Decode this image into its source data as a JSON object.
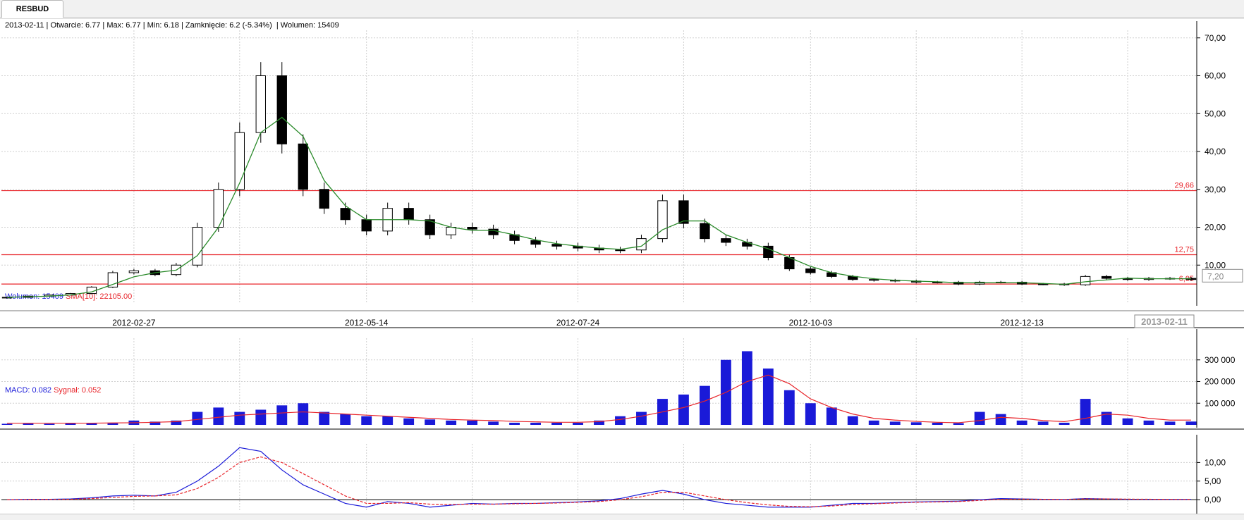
{
  "tab": {
    "label": "RESBUD"
  },
  "price_header": {
    "date": "2013-02-11",
    "open": "Otwarcie: 6.77",
    "high": "Max: 6.77",
    "low": "Min: 6.18",
    "close": "Zamknięcie: 6.2 (-5.34%)",
    "volume": "Wolumen: 15409"
  },
  "volume_header": {
    "volume": "Wolumen: 15409",
    "sma": "SMA[10]: 22105.00"
  },
  "macd_header": {
    "macd": "MACD: 0.082",
    "signal": "Sygnał: 0.052"
  },
  "x_cursor_label": "2013-02-11",
  "y_cursor_label": "7,20",
  "colors": {
    "grid": "#cfcfcf",
    "level": "#e8242a",
    "sma_line": "#2a8a2a",
    "volume_bar": "#1a1ad8",
    "volume_sma": "#e8242a",
    "macd": "#1a1ad8",
    "signal": "#e8242a",
    "candle": "#000000"
  },
  "chart_data": [
    {
      "type": "candlestick",
      "title": "RESBUD",
      "x_tick_labels": [
        "2012-02-27",
        "2012-05-14",
        "2012-07-24",
        "2012-10-03",
        "2012-12-13"
      ],
      "y_tick_labels": [
        "10,00",
        "20,00",
        "30,00",
        "40,00",
        "50,00",
        "60,00",
        "70,00"
      ],
      "ylim": [
        0,
        72
      ],
      "grid": true,
      "horizontal_levels": [
        {
          "value": 29.66,
          "label": "29,66"
        },
        {
          "value": 12.75,
          "label": "12,75"
        },
        {
          "value": 5.0,
          "label": "6,05"
        }
      ],
      "x": [
        "2012-01-16",
        "2012-01-23",
        "2012-01-30",
        "2012-02-06",
        "2012-02-13",
        "2012-02-20",
        "2012-02-27",
        "2012-03-05",
        "2012-03-12",
        "2012-03-19",
        "2012-03-26",
        "2012-04-02",
        "2012-04-09",
        "2012-04-16",
        "2012-04-23",
        "2012-04-30",
        "2012-05-07",
        "2012-05-14",
        "2012-05-21",
        "2012-05-28",
        "2012-06-04",
        "2012-06-11",
        "2012-06-18",
        "2012-06-25",
        "2012-07-02",
        "2012-07-09",
        "2012-07-16",
        "2012-07-23",
        "2012-07-30",
        "2012-08-06",
        "2012-08-13",
        "2012-08-20",
        "2012-08-27",
        "2012-09-03",
        "2012-09-10",
        "2012-09-17",
        "2012-09-24",
        "2012-10-01",
        "2012-10-08",
        "2012-10-15",
        "2012-10-22",
        "2012-10-29",
        "2012-11-05",
        "2012-11-12",
        "2012-11-19",
        "2012-11-26",
        "2012-12-03",
        "2012-12-10",
        "2012-12-17",
        "2012-12-24",
        "2012-12-31",
        "2013-01-07",
        "2013-01-14",
        "2013-01-21",
        "2013-01-28",
        "2013-02-04",
        "2013-02-11"
      ],
      "close": [
        1.5,
        1.8,
        2.1,
        2.5,
        4.2,
        8.0,
        8.5,
        7.5,
        10.0,
        20.0,
        30.0,
        45.0,
        60.0,
        42.0,
        30.0,
        25.0,
        22.0,
        19.0,
        25.0,
        22.0,
        18.0,
        20.0,
        19.5,
        18.0,
        16.5,
        15.5,
        15.0,
        14.5,
        14.0,
        14.0,
        17.0,
        27.0,
        21.0,
        17.0,
        16.0,
        15.0,
        12.0,
        9.0,
        8.0,
        7.0,
        6.2,
        6.0,
        5.8,
        5.5,
        5.5,
        5.0,
        5.5,
        5.5,
        5.0,
        5.0,
        4.8,
        7.0,
        6.5,
        6.2,
        6.5,
        6.5,
        6.2
      ],
      "volume": [
        5000,
        6000,
        5000,
        7000,
        8000,
        10000,
        20000,
        15000,
        20000,
        60000,
        80000,
        60000,
        70000,
        90000,
        100000,
        60000,
        50000,
        40000,
        40000,
        30000,
        25000,
        20000,
        20000,
        15000,
        10000,
        10000,
        10000,
        10000,
        20000,
        40000,
        60000,
        120000,
        140000,
        180000,
        300000,
        340000,
        260000,
        160000,
        100000,
        80000,
        40000,
        20000,
        15000,
        12000,
        10000,
        8000,
        60000,
        50000,
        20000,
        15000,
        10000,
        120000,
        60000,
        30000,
        20000,
        15000,
        15409
      ],
      "volume_sma": [
        8000,
        8000,
        8000,
        8000,
        8000,
        9000,
        10000,
        12000,
        15000,
        25000,
        35000,
        45000,
        50000,
        55000,
        60000,
        55000,
        50000,
        45000,
        40000,
        35000,
        30000,
        25000,
        22000,
        20000,
        16000,
        14000,
        12000,
        12000,
        15000,
        25000,
        40000,
        60000,
        80000,
        110000,
        150000,
        200000,
        230000,
        190000,
        120000,
        80000,
        50000,
        30000,
        22000,
        16000,
        12000,
        10000,
        20000,
        35000,
        30000,
        20000,
        15000,
        30000,
        50000,
        45000,
        30000,
        22000,
        22105
      ],
      "volume_y_tick_labels": [
        "100 000",
        "200 000",
        "300 000"
      ],
      "macd": [
        0.0,
        0.1,
        0.1,
        0.2,
        0.5,
        1.0,
        1.2,
        1.0,
        2.0,
        5.0,
        9.0,
        14.0,
        13.0,
        8.0,
        4.0,
        1.5,
        -1.0,
        -2.0,
        -0.5,
        -1.0,
        -2.0,
        -1.5,
        -1.0,
        -1.2,
        -1.0,
        -1.0,
        -0.8,
        -0.6,
        -0.3,
        0.3,
        1.5,
        2.5,
        1.5,
        0.0,
        -1.0,
        -1.5,
        -2.0,
        -2.0,
        -2.0,
        -1.5,
        -1.0,
        -1.0,
        -0.8,
        -0.6,
        -0.5,
        -0.4,
        0.0,
        0.3,
        0.2,
        0.1,
        0.05,
        0.3,
        0.2,
        0.1,
        0.1,
        0.08,
        0.082
      ],
      "signal": [
        0.0,
        0.05,
        0.08,
        0.1,
        0.3,
        0.6,
        0.9,
        1.0,
        1.3,
        3.0,
        6.0,
        10.0,
        11.5,
        10.0,
        7.0,
        4.0,
        1.0,
        -1.0,
        -1.0,
        -0.8,
        -1.2,
        -1.3,
        -1.2,
        -1.2,
        -1.1,
        -1.0,
        -0.9,
        -0.7,
        -0.5,
        0.0,
        0.8,
        2.0,
        2.0,
        1.0,
        0.0,
        -0.8,
        -1.4,
        -1.8,
        -1.9,
        -1.7,
        -1.3,
        -1.1,
        -0.9,
        -0.7,
        -0.6,
        -0.5,
        -0.2,
        0.1,
        0.15,
        0.1,
        0.07,
        0.2,
        0.2,
        0.15,
        0.12,
        0.09,
        0.052
      ],
      "macd_y_tick_labels": [
        "0,00",
        "5,00",
        "10,00"
      ]
    }
  ]
}
